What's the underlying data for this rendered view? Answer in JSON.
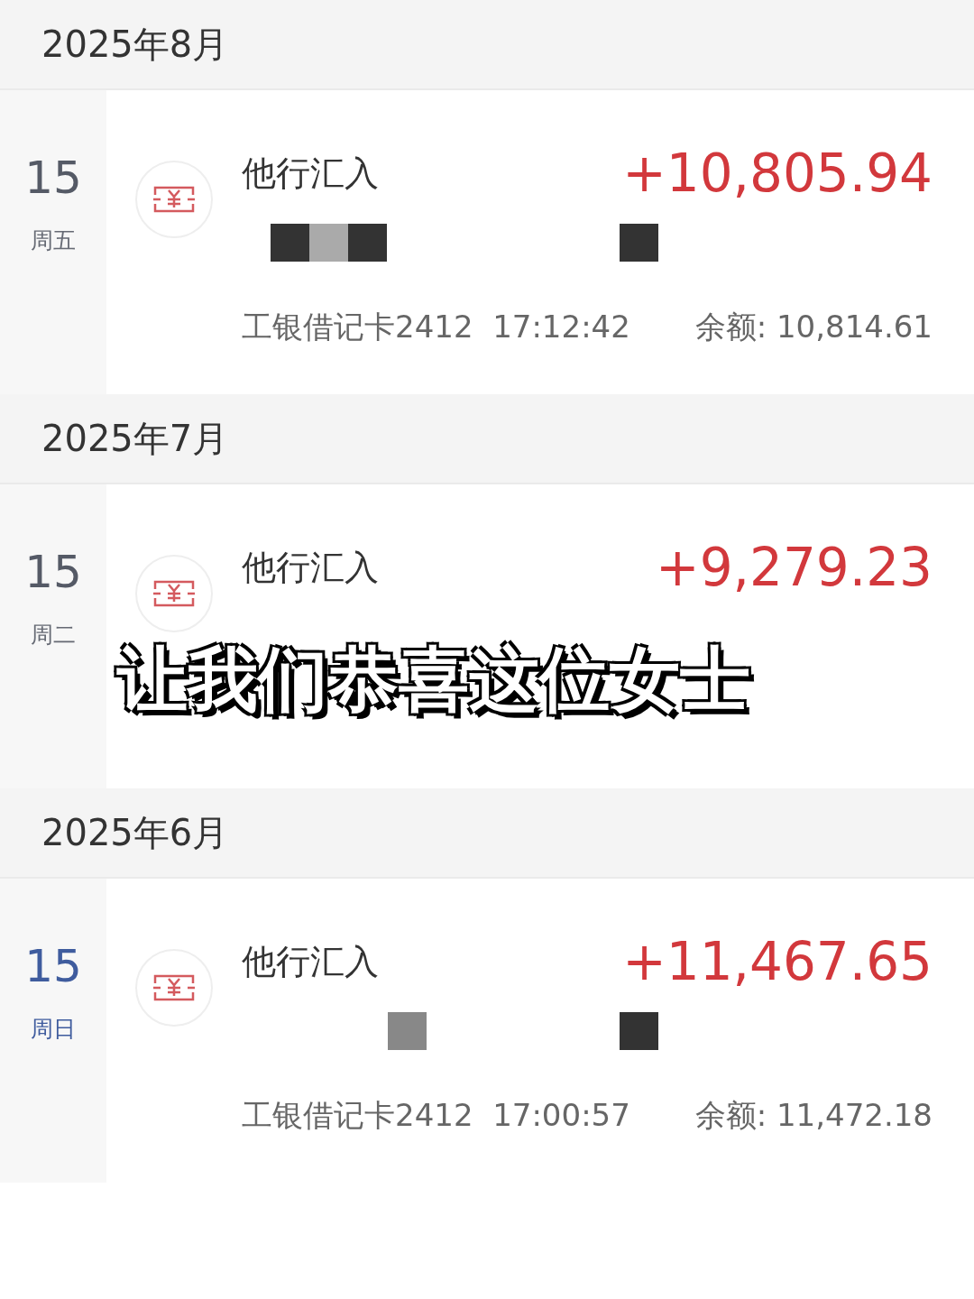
{
  "months": [
    {
      "label": "2025年8月",
      "entries": [
        {
          "day": "15",
          "weekday": "周五",
          "weekend": false,
          "title": "他行汇入",
          "amount": "+10,805.94",
          "redacted": true,
          "card": "工银借记卡2412",
          "time": "17:12:42",
          "balance": "余额: 10,814.61"
        }
      ]
    },
    {
      "label": "2025年7月",
      "entries": [
        {
          "day": "15",
          "weekday": "周二",
          "weekend": false,
          "title": "他行汇入",
          "amount": "+9,279.23",
          "redacted": false
        }
      ]
    },
    {
      "label": "2025年6月",
      "entries": [
        {
          "day": "15",
          "weekday": "周日",
          "weekend": true,
          "title": "他行汇入",
          "amount": "+11,467.65",
          "redacted": true,
          "card": "工银借记卡2412",
          "time": "17:00:57",
          "balance": "余额: 11,472.18"
        }
      ]
    }
  ],
  "caption": "让我们恭喜这位女士"
}
